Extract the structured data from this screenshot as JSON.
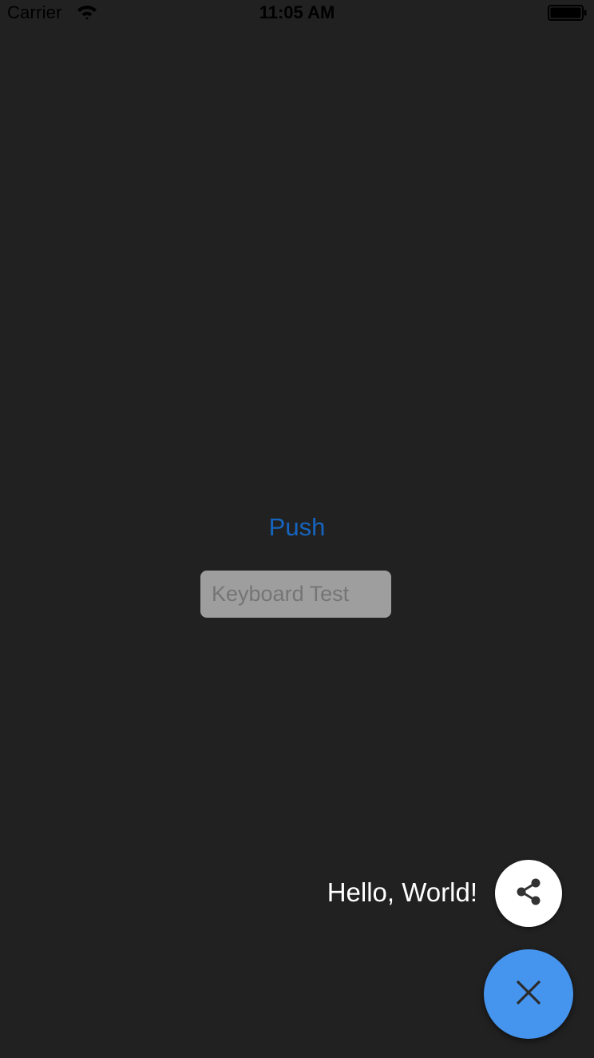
{
  "status_bar": {
    "carrier": "Carrier",
    "time": "11:05 AM",
    "wifi_icon": "wifi-icon",
    "battery_icon": "battery-full-icon"
  },
  "main": {
    "push_label": "Push",
    "keyboard_input": {
      "value": "",
      "placeholder": "Keyboard Test"
    }
  },
  "fab": {
    "mini_label": "Hello, World!",
    "mini_icon": "share-icon",
    "main_icon": "close-icon"
  },
  "colors": {
    "background": "#212121",
    "link": "#1565c0",
    "input_background": "#9e9e9e",
    "fab_main": "#4595ef",
    "fab_mini": "#ffffff"
  }
}
